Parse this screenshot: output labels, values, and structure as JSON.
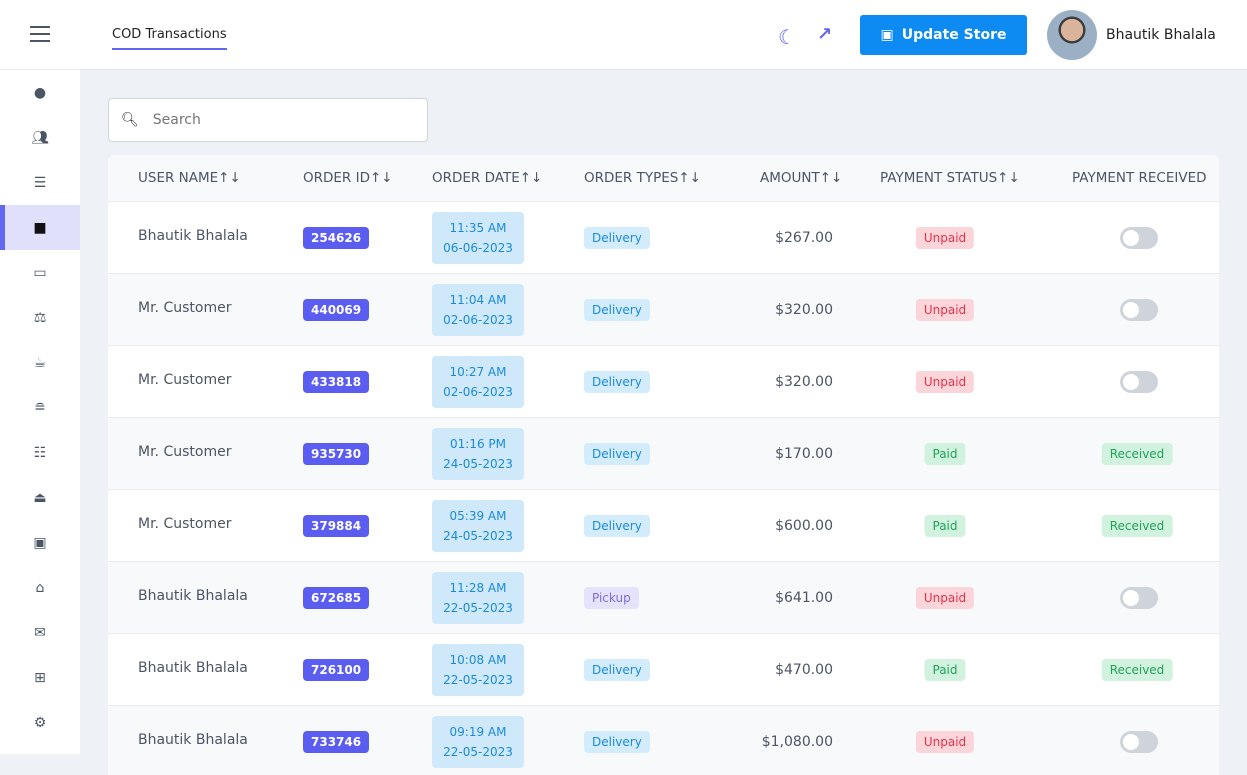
{
  "header": {
    "tab": "COD Transactions",
    "update_store": "Update Store",
    "user_name": "Bhautik Bhalala"
  },
  "sidebar": {
    "icons": [
      "dashboard",
      "users",
      "categories",
      "orders",
      "tickets",
      "balance",
      "coffee",
      "burger",
      "list",
      "serving",
      "money",
      "home",
      "mail",
      "gift",
      "settings"
    ],
    "active": 3
  },
  "search": {
    "placeholder": "Search",
    "value": ""
  },
  "table": {
    "columns": [
      "USER NAME↑↓",
      "ORDER ID↑↓",
      "ORDER DATE↑↓",
      "ORDER TYPES↑↓",
      "AMOUNT↑↓",
      "PAYMENT STATUS↑↓",
      "PAYMENT RECEIVED"
    ],
    "rows": [
      {
        "user": "Bhautik Bhalala",
        "id": "254626",
        "time": "11:35 AM",
        "date": "06-06-2023",
        "type": "Delivery",
        "amount": "$267.00",
        "status": "Unpaid",
        "received": ""
      },
      {
        "user": "Mr. Customer",
        "id": "440069",
        "time": "11:04 AM",
        "date": "02-06-2023",
        "type": "Delivery",
        "amount": "$320.00",
        "status": "Unpaid",
        "received": ""
      },
      {
        "user": "Mr. Customer",
        "id": "433818",
        "time": "10:27 AM",
        "date": "02-06-2023",
        "type": "Delivery",
        "amount": "$320.00",
        "status": "Unpaid",
        "received": ""
      },
      {
        "user": "Mr. Customer",
        "id": "935730",
        "time": "01:16 PM",
        "date": "24-05-2023",
        "type": "Delivery",
        "amount": "$170.00",
        "status": "Paid",
        "received": "Received"
      },
      {
        "user": "Mr. Customer",
        "id": "379884",
        "time": "05:39 AM",
        "date": "24-05-2023",
        "type": "Delivery",
        "amount": "$600.00",
        "status": "Paid",
        "received": "Received"
      },
      {
        "user": "Bhautik Bhalala",
        "id": "672685",
        "time": "11:28 AM",
        "date": "22-05-2023",
        "type": "Pickup",
        "amount": "$641.00",
        "status": "Unpaid",
        "received": ""
      },
      {
        "user": "Bhautik Bhalala",
        "id": "726100",
        "time": "10:08 AM",
        "date": "22-05-2023",
        "type": "Delivery",
        "amount": "$470.00",
        "status": "Paid",
        "received": "Received"
      },
      {
        "user": "Bhautik Bhalala",
        "id": "733746",
        "time": "09:19 AM",
        "date": "22-05-2023",
        "type": "Delivery",
        "amount": "$1,080.00",
        "status": "Unpaid",
        "received": ""
      }
    ]
  }
}
